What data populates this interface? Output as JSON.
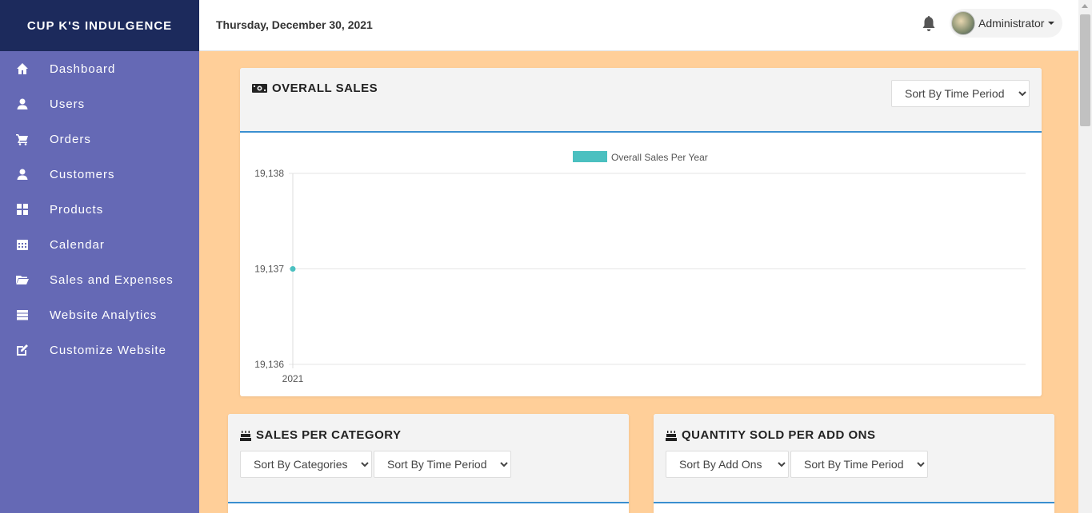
{
  "sidebar": {
    "brand": "CUP K'S INDULGENCE",
    "items": [
      {
        "label": "Dashboard",
        "icon": "home-icon"
      },
      {
        "label": "Users",
        "icon": "user-icon"
      },
      {
        "label": "Orders",
        "icon": "cart-icon"
      },
      {
        "label": "Customers",
        "icon": "user-icon"
      },
      {
        "label": "Products",
        "icon": "grid-icon"
      },
      {
        "label": "Calendar",
        "icon": "calendar-icon"
      },
      {
        "label": "Sales and Expenses",
        "icon": "folder-icon"
      },
      {
        "label": "Website Analytics",
        "icon": "server-icon"
      },
      {
        "label": "Customize Website",
        "icon": "edit-icon"
      }
    ],
    "color": "#6569b5",
    "brand_color": "#1c2a5c"
  },
  "header": {
    "date": "Thursday, December 30, 2021",
    "user": "Administrator"
  },
  "overall_sales": {
    "title": "OVERALL SALES",
    "sort_select": "Sort By Time Period"
  },
  "sales_per_category": {
    "title": "SALES PER CATEGORY",
    "sort_category": "Sort By Categories",
    "sort_time": "Sort By Time Period"
  },
  "quantity_add_ons": {
    "title": "QUANTITY SOLD PER ADD ONS",
    "sort_addons": "Sort By Add Ons",
    "sort_time": "Sort By Time Period"
  },
  "chart_data": {
    "type": "line",
    "x": [
      "2021"
    ],
    "series": [
      {
        "name": "Overall Sales Per Year",
        "values": [
          19137
        ]
      }
    ],
    "ylim": [
      19136,
      19138
    ],
    "yticks": [
      "19,138",
      "19,137",
      "19,136"
    ],
    "legend": "top-center",
    "grid": true,
    "color": "#4bc0c0"
  },
  "colors": {
    "page_bg": "#ffcf99",
    "accent": "#3a8fd0"
  }
}
